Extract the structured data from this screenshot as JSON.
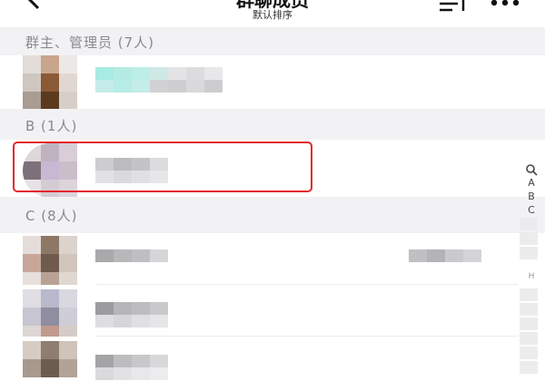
{
  "header": {
    "title": "群聊成员",
    "subtitle": "默认排序",
    "back_icon": "chevron-left-icon",
    "sort_icon": "sort-icon",
    "more_icon": "more-dots-icon"
  },
  "sections": [
    {
      "label": "群主、管理员 (7人)"
    },
    {
      "label": "B (1人)"
    },
    {
      "label": "C (8人)"
    }
  ],
  "index_bar": {
    "search_icon": "search-icon",
    "letters": [
      "A",
      "B",
      "C",
      "H"
    ]
  },
  "colors": {
    "highlight_border": "#e3262b",
    "section_bg": "#f2f2f4",
    "section_text": "#8a8a8e"
  }
}
